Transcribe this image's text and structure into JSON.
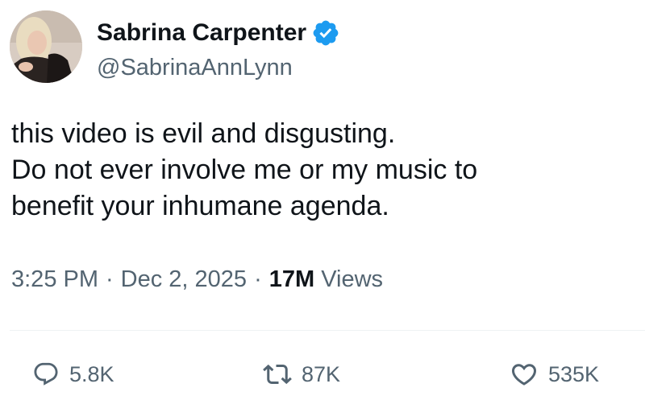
{
  "author": {
    "display_name": "Sabrina Carpenter",
    "handle": "@SabrinaAnnLynn",
    "verified": true
  },
  "tweet": {
    "lines": [
      "this video is evil and disgusting.",
      "Do not ever involve me or my music to",
      "benefit your inhumane agenda."
    ]
  },
  "meta": {
    "time": "3:25 PM",
    "separator": "·",
    "date": "Dec 2, 2025",
    "views_count": "17M",
    "views_label": "Views"
  },
  "actions": {
    "replies": "5.8K",
    "reposts": "87K",
    "likes": "535K"
  },
  "colors": {
    "text": "#0f1419",
    "secondary": "#536471",
    "verified": "#1d9bf0",
    "divider": "#eff3f4"
  },
  "icons": [
    "verified-badge-icon",
    "reply-icon",
    "repost-icon",
    "like-icon"
  ]
}
